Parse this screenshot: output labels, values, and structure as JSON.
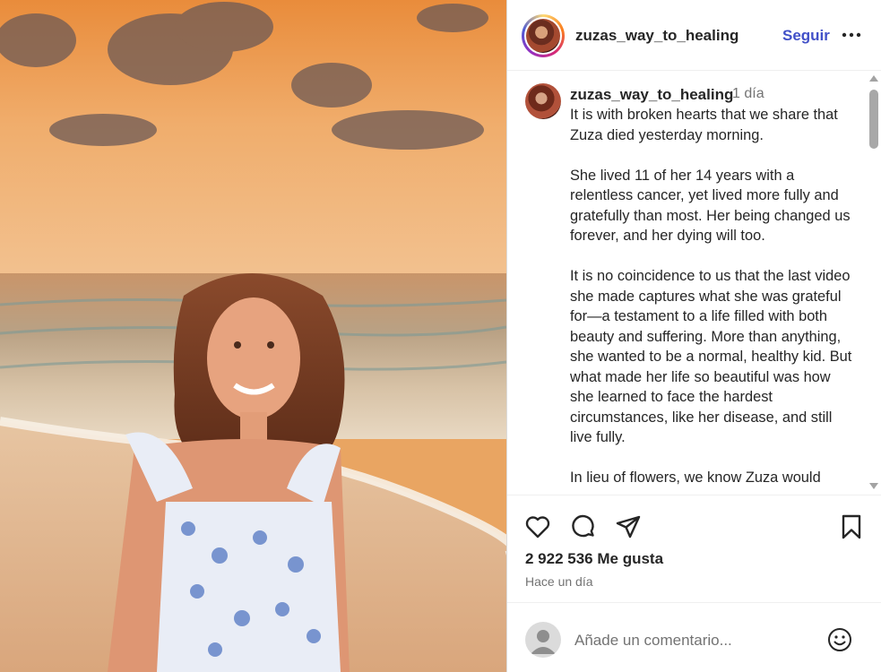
{
  "post": {
    "username": "zuzas_way_to_healing",
    "follow_label": "Seguir",
    "more_icon": "more-options-icon"
  },
  "caption": {
    "username": "zuzas_way_to_healing",
    "time": "1 día",
    "text": "It is with broken hearts that we share that Zuza died yesterday morning.\n\nShe lived 11 of her 14 years with a relentless cancer, yet lived more fully and gratefully than most. Her being changed us forever, and her dying will too.\n\nIt is no coincidence to us that the last video she made captures what she was grateful for—a testament to a life filled with both beauty and suffering. More than anything, she wanted to be a normal, healthy kid. But what made her life so beautiful was how she learned to face the hardest circumstances, like her disease, and still live fully.\n\nIn lieu of flowers, we know Zuza would"
  },
  "actions": {
    "icons": [
      "heart-icon",
      "comment-icon",
      "share-icon",
      "bookmark-icon"
    ],
    "likes": "2 922 536 Me gusta",
    "date": "Hace un día"
  },
  "comment_box": {
    "placeholder": "Añade un comentario...",
    "emoji_icon": "emoji-icon"
  },
  "colors": {
    "follow_blue": "#4150c8",
    "text": "#262626",
    "secondary_text": "#737373"
  }
}
